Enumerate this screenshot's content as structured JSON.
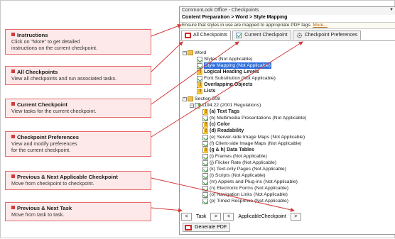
{
  "callouts": [
    {
      "title": "Instructions",
      "desc": [
        "Click on \"More\" to get detailed",
        "instructions on the current checkpoint."
      ]
    },
    {
      "title": "All Checkpoints",
      "desc": [
        "View all checkpoints and run associated tasks."
      ]
    },
    {
      "title": "Current Checkpoint",
      "desc": [
        "View tasks for the current checkpoint."
      ]
    },
    {
      "title": "Checkpoint Preferences",
      "desc": [
        "View and modify preferences",
        "for the current checkpoint."
      ]
    },
    {
      "title": "Previous & Next Applicable Checkpoint",
      "desc": [
        "Move from checkpoint to checkpoint."
      ]
    },
    {
      "title": "Previous & Next Task",
      "desc": [
        "Move from task to task."
      ]
    }
  ],
  "panel": {
    "title": "CommonLook Office - Checkpoints",
    "breadcrumb": "Content Preparation > Word > Style Mapping",
    "instruction_text": "Ensure that styles in use are mapped to appropriate PDF tags.",
    "more_link": "More...",
    "tabs": [
      "All Checkpoints",
      "Current Checkpoint",
      "Checkpoint Preferences"
    ],
    "tree": [
      {
        "label": "Word",
        "icon": "folder",
        "bold": false
      },
      {
        "label": "Styles (Not Applicable)",
        "icon": "page",
        "bold": false
      },
      {
        "label": "Style Mapping (Not Applicable)",
        "icon": "page",
        "bold": false,
        "selected": true
      },
      {
        "label": "Logical Heading Levels",
        "icon": "warn",
        "bold": true
      },
      {
        "label": "Font Substitution (Not Applicable)",
        "icon": "page",
        "bold": false
      },
      {
        "label": "Overlapping Objects",
        "icon": "warn",
        "bold": true
      },
      {
        "label": "Lists",
        "icon": "warn",
        "bold": true
      },
      {
        "label": "Section 508",
        "icon": "folder",
        "bold": false
      },
      {
        "label": "1194.22 (2001 Regulations)",
        "icon": "folderdoc",
        "bold": false
      },
      {
        "label": "(a) Text Tags",
        "icon": "warn",
        "bold": true
      },
      {
        "label": "(b) Multimedia Presentations (Not Applicable)",
        "icon": "page",
        "bold": false
      },
      {
        "label": "(c) Color",
        "icon": "warn",
        "bold": true
      },
      {
        "label": "(d) Readability",
        "icon": "warn",
        "bold": true
      },
      {
        "label": "(e) Server-side Image Maps (Not Applicable)",
        "icon": "page",
        "bold": false
      },
      {
        "label": "(f) Client-side Image Maps (Not Applicable)",
        "icon": "page",
        "bold": false
      },
      {
        "label": "(g & h) Data Tables",
        "icon": "warn",
        "bold": true
      },
      {
        "label": "(i) Frames (Not Applicable)",
        "icon": "page",
        "bold": false
      },
      {
        "label": "(j) Flicker Rate (Not Applicable)",
        "icon": "page",
        "bold": false
      },
      {
        "label": "(k) Text-only Pages (Not Applicable)",
        "icon": "page",
        "bold": false
      },
      {
        "label": "(l) Scripts (Not Applicable)",
        "icon": "page",
        "bold": false
      },
      {
        "label": "(m) Applets and Plug-ins (Not Applicable)",
        "icon": "page",
        "bold": false
      },
      {
        "label": "(n) Electronic Forms (Not Applicable)",
        "icon": "page",
        "bold": false
      },
      {
        "label": "(o) Navigation Links (Not Applicable)",
        "icon": "page",
        "bold": false
      },
      {
        "label": "(p) Timed Response (Not Applicable)",
        "icon": "page",
        "bold": false
      }
    ],
    "nav": {
      "prev": "<",
      "task_label": "Task",
      "next": ">",
      "prev2": "<",
      "checkpoint_label": "ApplicableCheckpoint",
      "next2": ">"
    },
    "generate_pdf": "Generate PDF"
  },
  "colors": {
    "callout_border": "#e56a6a",
    "callout_fill": "#fde9e9",
    "arrow": "#d23a3a",
    "selection": "#2f6fdb"
  },
  "icons": {
    "tab_all": "checkpoint-list-icon",
    "tab_current": "document-check-icon",
    "tab_prefs": "gear-icon",
    "pdf": "pdf-icon"
  }
}
